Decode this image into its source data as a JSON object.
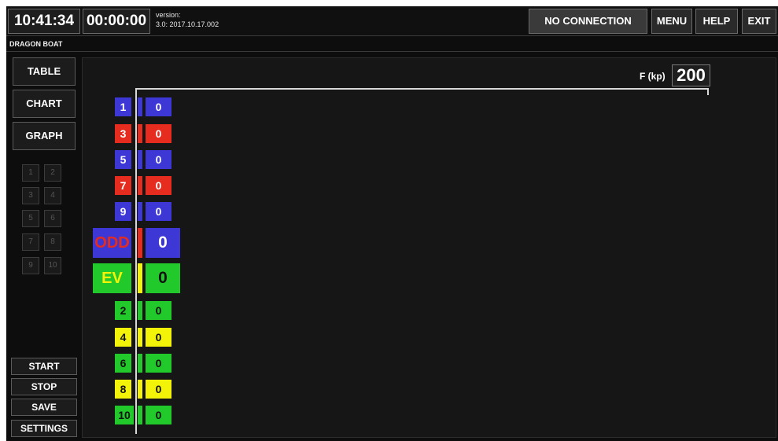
{
  "header": {
    "clock": "10:41:34",
    "timer": "00:00:00",
    "version_label": "version:",
    "version_value": "3.0: 2017.10.17.002",
    "connection_status": "NO CONNECTION",
    "menu_label": "MENU",
    "help_label": "HELP",
    "exit_label": "EXIT"
  },
  "subheader": {
    "title": "DRAGON BOAT"
  },
  "sidebar": {
    "table_label": "TABLE",
    "chart_label": "CHART",
    "graph_label": "GRAPH",
    "number_buttons": [
      "1",
      "2",
      "3",
      "4",
      "5",
      "6",
      "7",
      "8",
      "9",
      "10"
    ],
    "start_label": "START",
    "stop_label": "STOP",
    "save_label": "SAVE",
    "settings_label": "SETTINGS"
  },
  "graph": {
    "force_label": "F (kp)",
    "force_max": "200",
    "rows": [
      {
        "label": "1",
        "value": "0",
        "color": "#3d37d6"
      },
      {
        "label": "3",
        "value": "0",
        "color": "#e62c1e"
      },
      {
        "label": "5",
        "value": "0",
        "color": "#3d37d6"
      },
      {
        "label": "7",
        "value": "0",
        "color": "#e62c1e"
      },
      {
        "label": "9",
        "value": "0",
        "color": "#3d37d6"
      },
      {
        "label": "ODD",
        "value": "0",
        "color": "#3d37d6",
        "label_text_color": "#e62c1e"
      },
      {
        "label": "EV",
        "value": "0",
        "color": "#22c92a",
        "label_text_color": "#f3f30a"
      },
      {
        "label": "2",
        "value": "0",
        "color": "#22c92a"
      },
      {
        "label": "4",
        "value": "0",
        "color": "#f3f30a"
      },
      {
        "label": "6",
        "value": "0",
        "color": "#22c92a"
      },
      {
        "label": "8",
        "value": "0",
        "color": "#f3f30a"
      },
      {
        "label": "10",
        "value": "0",
        "color": "#22c92a"
      }
    ]
  }
}
